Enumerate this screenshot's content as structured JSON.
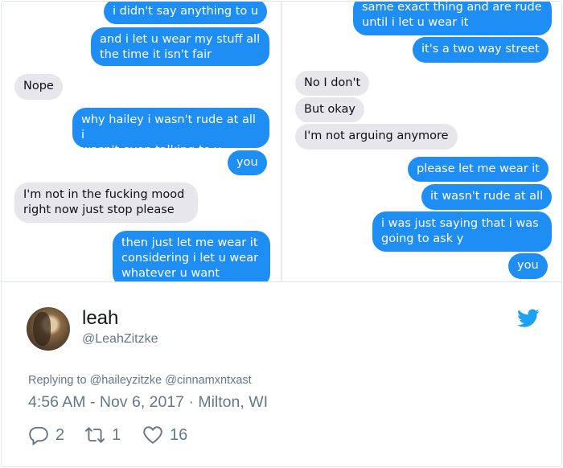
{
  "conversation": {
    "left": [
      {
        "text": "i didn't say anything to u",
        "from": "sent"
      },
      {
        "text": "and i let u wear my stuff all\nthe time it isn't fair",
        "from": "sent"
      },
      {
        "text": "Nope",
        "from": "received"
      },
      {
        "text": "why hailey i wasn't rude at all i\nwasn't even talking to y",
        "from": "sent"
      },
      {
        "text": "you",
        "from": "sent"
      },
      {
        "text": "I'm not in the fucking mood\nright now just stop please",
        "from": "received"
      },
      {
        "text": "then just let me wear it\nconsidering i let u wear\nwhatever u want",
        "from": "sent"
      }
    ],
    "right": [
      {
        "text": "same exact thing and are rude\nuntil i let u wear it",
        "from": "sent"
      },
      {
        "text": "it's a two way street",
        "from": "sent"
      },
      {
        "text": "No I don't",
        "from": "received"
      },
      {
        "text": "But okay",
        "from": "received"
      },
      {
        "text": "I'm not arguing anymore",
        "from": "received"
      },
      {
        "text": "please let me wear it",
        "from": "sent"
      },
      {
        "text": "it wasn't rude at all",
        "from": "sent"
      },
      {
        "text": "i was just saying that i was\ngoing to ask y",
        "from": "sent"
      },
      {
        "text": "you",
        "from": "sent"
      }
    ]
  },
  "user": {
    "name": "leah",
    "handle": "@LeahZitzke"
  },
  "tweet": {
    "replying_to": "Replying to @haileyzitzke @cinnamxntxast",
    "timestamp": "4:56 AM - Nov 6, 2017 · Milton, WI"
  },
  "actions": {
    "replies": "2",
    "retweets": "1",
    "likes": "16"
  },
  "colors": {
    "sent_bubble": "#1e8ef5",
    "received_bubble": "#e6e6eb",
    "twitter_blue": "#1da1f2",
    "muted": "#657786"
  },
  "icons": [
    "reply-icon",
    "retweet-icon",
    "heart-icon",
    "twitter-bird-icon"
  ]
}
